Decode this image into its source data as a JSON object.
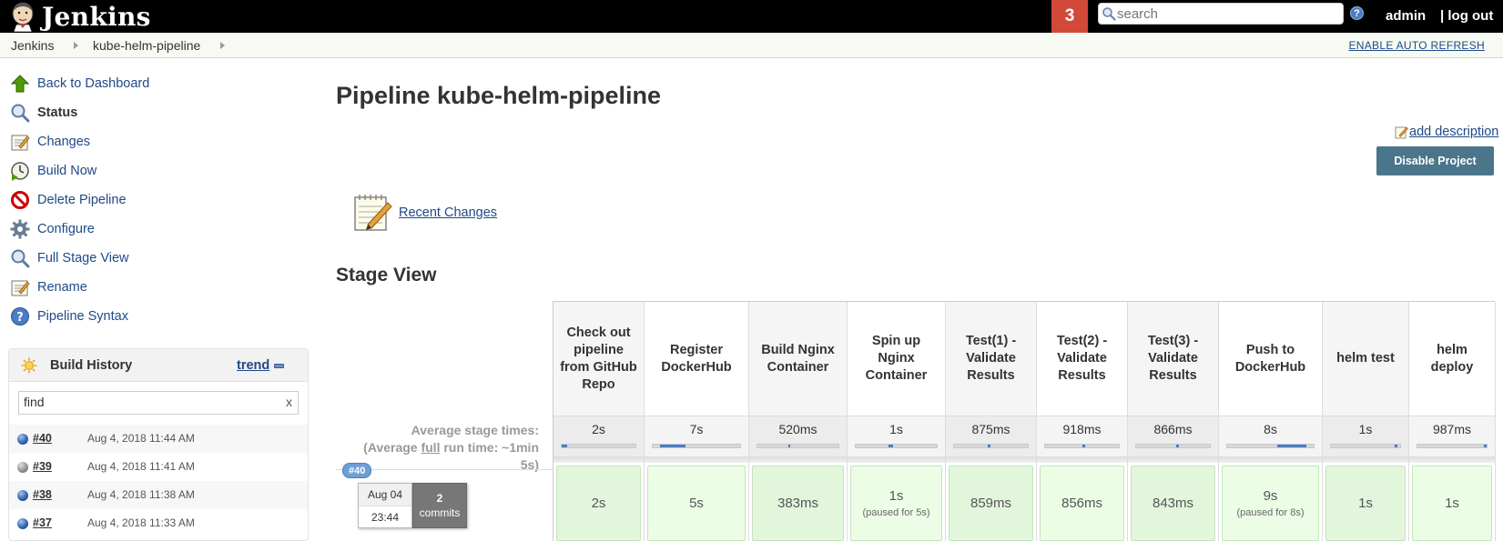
{
  "header": {
    "brand": "Jenkins",
    "notification_count": "3",
    "search_placeholder": "search",
    "help": "?",
    "user": "admin",
    "logout": "| log out"
  },
  "breadcrumb": {
    "items": [
      "Jenkins",
      "kube-helm-pipeline"
    ],
    "auto_refresh": "ENABLE AUTO REFRESH"
  },
  "sidebar": {
    "tasks": [
      {
        "label": "Back to Dashboard",
        "icon": "up-arrow-icon"
      },
      {
        "label": "Status",
        "icon": "search-icon"
      },
      {
        "label": "Changes",
        "icon": "notepad-icon"
      },
      {
        "label": "Build Now",
        "icon": "clock-play-icon"
      },
      {
        "label": "Delete Pipeline",
        "icon": "no-entry-icon"
      },
      {
        "label": "Configure",
        "icon": "gear-icon"
      },
      {
        "label": "Full Stage View",
        "icon": "search-icon"
      },
      {
        "label": "Rename",
        "icon": "notepad-icon"
      },
      {
        "label": "Pipeline Syntax",
        "icon": "help-icon"
      }
    ],
    "build_history": {
      "title": "Build History",
      "trend": "trend",
      "filter_value": "find",
      "clear": "x",
      "builds": [
        {
          "num": "#40",
          "date": "Aug 4, 2018 11:44 AM",
          "status": "blue"
        },
        {
          "num": "#39",
          "date": "Aug 4, 2018 11:41 AM",
          "status": "grey"
        },
        {
          "num": "#38",
          "date": "Aug 4, 2018 11:38 AM",
          "status": "blue"
        },
        {
          "num": "#37",
          "date": "Aug 4, 2018 11:33 AM",
          "status": "blue"
        }
      ]
    }
  },
  "main": {
    "title": "Pipeline kube-helm-pipeline",
    "add_description": "add description",
    "disable_project": "Disable Project",
    "recent_changes": "Recent Changes",
    "stage_view_title": "Stage View",
    "avg_label_1": "Average stage times:",
    "avg_label_2a": "(Average ",
    "avg_label_2b": "full",
    "avg_label_2c": " run time: ~1min",
    "avg_label_3": "5s)",
    "run": {
      "badge": "#40",
      "date": "Aug 04",
      "time": "23:44",
      "commits_count": "2",
      "commits_label": "commits"
    },
    "stages": [
      {
        "name": "Check out pipeline from GitHub Repo",
        "avg": "2s",
        "avg_frac": 0.08,
        "avg_pos": 0.0,
        "run": "2s",
        "paused": ""
      },
      {
        "name": "Register DockerHub",
        "avg": "7s",
        "avg_frac": 0.3,
        "avg_pos": 0.08,
        "run": "5s",
        "paused": ""
      },
      {
        "name": "Build Nginx Container",
        "avg": "520ms",
        "avg_frac": 0.03,
        "avg_pos": 0.38,
        "run": "383ms",
        "paused": ""
      },
      {
        "name": "Spin up Nginx Container",
        "avg": "1s",
        "avg_frac": 0.05,
        "avg_pos": 0.41,
        "run": "1s",
        "paused": "(paused for 5s)"
      },
      {
        "name": "Test(1) - Validate Results",
        "avg": "875ms",
        "avg_frac": 0.04,
        "avg_pos": 0.46,
        "run": "859ms",
        "paused": ""
      },
      {
        "name": "Test(2) - Validate Results",
        "avg": "918ms",
        "avg_frac": 0.04,
        "avg_pos": 0.5,
        "run": "856ms",
        "paused": ""
      },
      {
        "name": "Test(3) - Validate Results",
        "avg": "866ms",
        "avg_frac": 0.04,
        "avg_pos": 0.54,
        "run": "843ms",
        "paused": ""
      },
      {
        "name": "Push to DockerHub",
        "avg": "8s",
        "avg_frac": 0.34,
        "avg_pos": 0.58,
        "run": "9s",
        "paused": "(paused for 8s)"
      },
      {
        "name": "helm test",
        "avg": "1s",
        "avg_frac": 0.04,
        "avg_pos": 0.92,
        "run": "1s",
        "paused": ""
      },
      {
        "name": "helm deploy",
        "avg": "987ms",
        "avg_frac": 0.04,
        "avg_pos": 0.96,
        "run": "1s",
        "paused": ""
      }
    ]
  },
  "colors": {
    "header_bg": "#000000",
    "notification_bg": "#d24939",
    "link": "#204a87",
    "success_cell": "#e2f6db",
    "button": "#4b758b"
  }
}
